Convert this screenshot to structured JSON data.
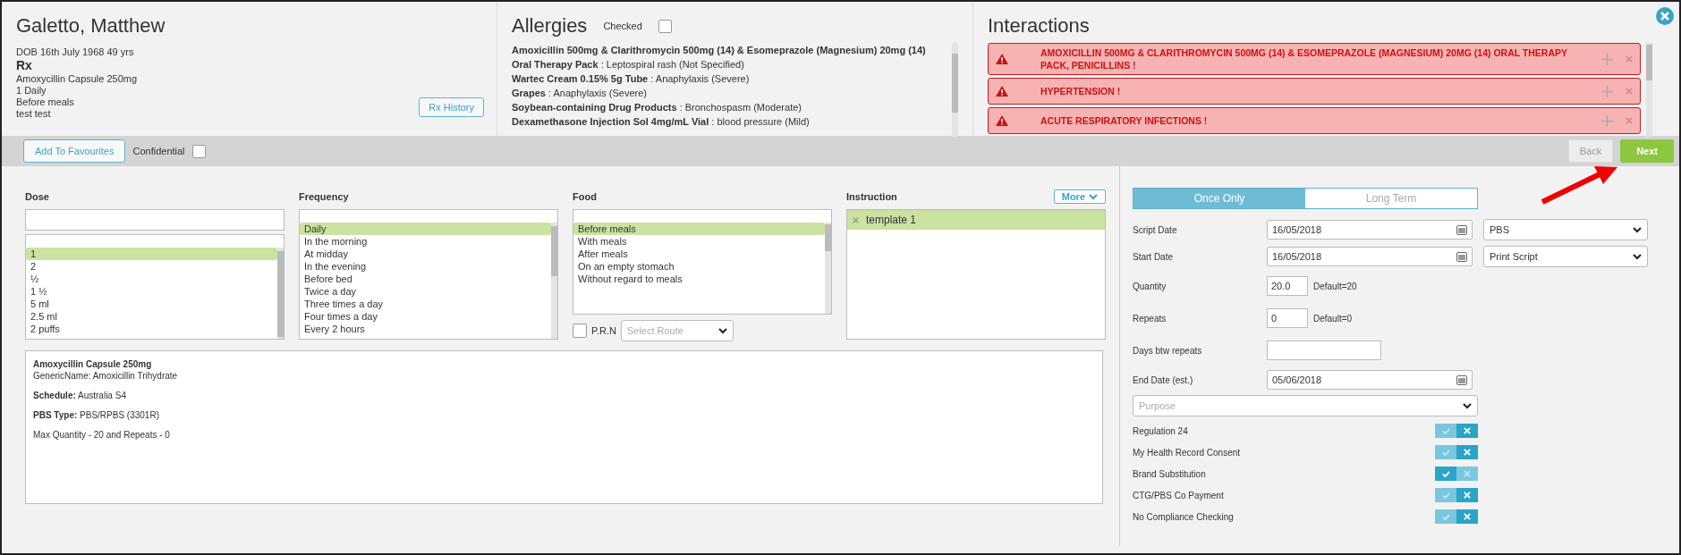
{
  "patient": {
    "name": "Galetto, Matthew",
    "dob": "DOB 16th July 1968 49 yrs",
    "rx_heading": "Rx",
    "rx_lines": [
      "Amoxycillin Capsule 250mg",
      "1 Daily",
      "Before meals",
      "test test"
    ],
    "history_button": "Rx History"
  },
  "allergies": {
    "title": "Allergies",
    "checked_label": "Checked",
    "checked": false,
    "items": [
      "**Amoxicillin 500mg & Clarithromycin 500mg (14) & Esomeprazole (Magnesium) 20mg (14) Oral Therapy Pack** : Leptospiral rash (Not Specified)",
      "**Wartec Cream 0.15% 5g Tube** : Anaphylaxis (Severe)",
      "**Grapes** : Anaphylaxis (Severe)",
      "**Soybean-containing Drug Products** : Bronchospasm (Moderate)",
      "**Dexamethasone Injection Sol 4mg/mL Vial** : blood pressure (Mild)"
    ]
  },
  "interactions": {
    "title": "Interactions",
    "items": [
      "AMOXICILLIN 500MG & CLARITHROMYCIN 500MG (14) & ESOMEPRAZOLE (MAGNESIUM) 20MG (14) ORAL THERAPY PACK, PENICILLINS !",
      "HYPERTENSION !",
      "ACUTE RESPIRATORY INFECTIONS !"
    ]
  },
  "toolbar": {
    "favourites_button": "Add To Favourites",
    "confidential_label": "Confidential",
    "confidential": false,
    "back_button": "Back",
    "next_button": "Next"
  },
  "dose": {
    "label": "Dose",
    "items": [
      {
        "text": "1",
        "selected": true
      },
      {
        "text": "2",
        "selected": false
      },
      {
        "text": "½",
        "selected": false
      },
      {
        "text": "1 ½",
        "selected": false
      },
      {
        "text": "5 ml",
        "selected": false
      },
      {
        "text": "2.5 ml",
        "selected": false
      },
      {
        "text": "2 puffs",
        "selected": false
      }
    ]
  },
  "frequency": {
    "label": "Frequency",
    "items": [
      {
        "text": "Daily",
        "selected": true
      },
      {
        "text": "In the morning",
        "selected": false
      },
      {
        "text": "At midday",
        "selected": false
      },
      {
        "text": "In the evening",
        "selected": false
      },
      {
        "text": "Before bed",
        "selected": false
      },
      {
        "text": "Twice a day",
        "selected": false
      },
      {
        "text": "Three times a day",
        "selected": false
      },
      {
        "text": "Four times a day",
        "selected": false
      },
      {
        "text": "Every 2 hours",
        "selected": false
      }
    ]
  },
  "food": {
    "label": "Food",
    "items": [
      {
        "text": "Before meals",
        "selected": true
      },
      {
        "text": "With meals",
        "selected": false
      },
      {
        "text": "After meals",
        "selected": false
      },
      {
        "text": "On an empty stomach",
        "selected": false
      },
      {
        "text": "Without regard to meals",
        "selected": false
      }
    ],
    "prn_label": "P.R.N",
    "prn": false,
    "route_placeholder": "Select Route"
  },
  "instruction": {
    "label": "Instruction",
    "more_button": "More",
    "items": [
      "template 1"
    ]
  },
  "details": [
    {
      "kind": "title",
      "text": "Amoxycillin Capsule 250mg"
    },
    {
      "kind": "line",
      "text": "GenericName: Amoxicillin Trihydrate"
    },
    {
      "kind": "para",
      "text": "**Schedule:** Australia S4"
    },
    {
      "kind": "para",
      "text": "**PBS Type:** PBS/RPBS (3301R)"
    },
    {
      "kind": "para",
      "text": "Max Quantity - 20 and Repeats - 0"
    }
  ],
  "term_tabs": [
    {
      "label": "Once Only",
      "selected": true
    },
    {
      "label": "Long Term",
      "selected": false
    }
  ],
  "form": [
    {
      "kind": "date",
      "label": "Script Date",
      "value": "16/05/2018",
      "side_select": "PBS"
    },
    {
      "kind": "date",
      "label": "Start Date",
      "value": "16/05/2018",
      "side_select": "Print Script"
    },
    {
      "kind": "number",
      "label": "Quantity",
      "value": "20.0",
      "hint": "Default=20"
    },
    {
      "kind": "number",
      "label": "Repeats",
      "value": "0",
      "hint": "Default=0"
    },
    {
      "kind": "text",
      "label": "Days btw repeats"
    },
    {
      "kind": "date",
      "label": "End Date (est.)",
      "value": "05/06/2018"
    }
  ],
  "purpose_placeholder": "Purpose",
  "toggles": [
    {
      "label": "Regulation 24",
      "on": false
    },
    {
      "label": "My Health Record Consent",
      "on": false
    },
    {
      "label": "Brand Substitution",
      "on": true
    },
    {
      "label": "CTG/PBS Co Payment",
      "on": false
    },
    {
      "label": "No Compliance Checking",
      "on": false
    }
  ]
}
